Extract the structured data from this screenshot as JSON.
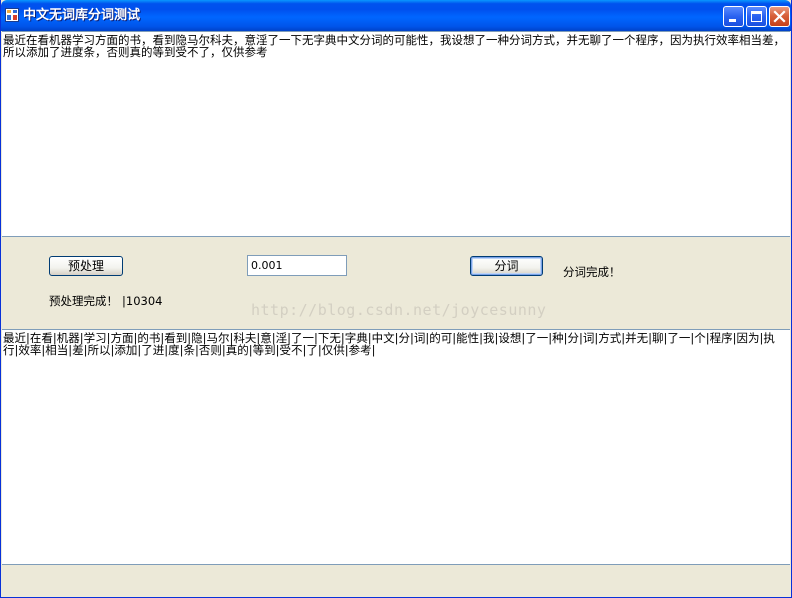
{
  "window": {
    "title": "中文无词库分词测试"
  },
  "input_text": "最近在看机器学习方面的书，看到隐马尔科夫，意淫了一下无字典中文分词的可能性，我设想了一种分词方式，并无聊了一个程序，因为执行效率相当差，所以添加了进度条，否则真的等到受不了，仅供参考",
  "controls": {
    "preprocess_button": "预处理",
    "threshold_value": "0.001",
    "segment_button": "分词",
    "preprocess_status": "预处理完成！",
    "preprocess_count": "|10304",
    "segment_status": "分词完成！"
  },
  "watermark": "http://blog.csdn.net/joycesunny",
  "output_text": "最近|在看|机器|学习|方面|的书|看到|隐|马尔|科夫|意|淫|了一|下无|字典|中文|分|词|的可|能性|我|设想|了一|种|分|词|方式|并无|聊|了一|个|程序|因为|执行|效率|相当|差|所以|添加|了进|度|条|否则|真的|等到|受不|了|仅供|参考|"
}
